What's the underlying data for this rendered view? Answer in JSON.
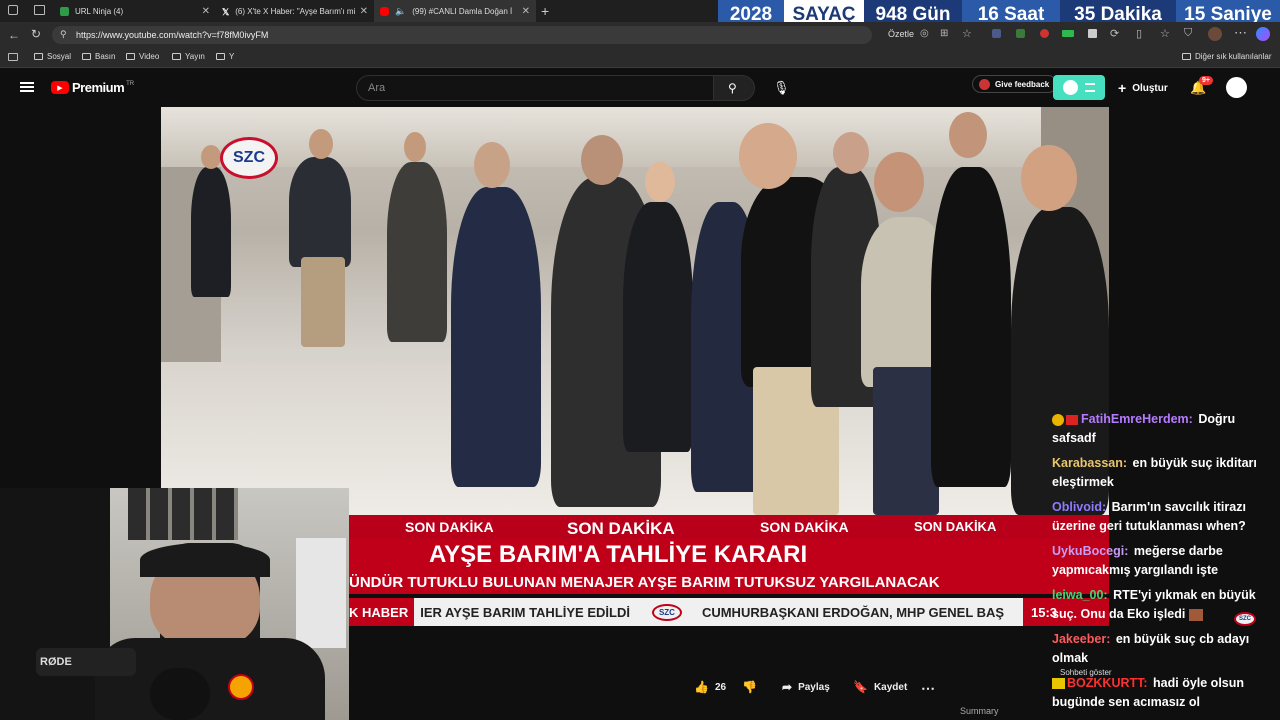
{
  "tabs": [
    {
      "label": "URL Ninja (4)",
      "color": "#2e9a4a"
    },
    {
      "label": "(6) X'te X Haber: \"Ayşe Barım'ı mi",
      "color": "#ffffff"
    },
    {
      "label": "(99) #CANLI Damla Doğan İ",
      "color": "#ff0000"
    }
  ],
  "counter": {
    "year": "2028",
    "label": "SAYAÇ",
    "days": "948 Gün",
    "hours": "16 Saat",
    "minutes": "35 Dakika",
    "seconds": "15 Saniye"
  },
  "address": {
    "url": "https://www.youtube.com/watch?v=f78fM0ivyFM",
    "summarize": "Özetle"
  },
  "bookmarks": [
    "Sosyal",
    "Basın",
    "Video",
    "Yayın",
    "Y"
  ],
  "other_bookmarks": "Diğer sık kullanılanlar",
  "youtube": {
    "brand": "Premium",
    "region": "TR",
    "search_placeholder": "Ara",
    "feedback": "Give feedback",
    "create": "Oluştur",
    "notif_count": "9+"
  },
  "overlay": {
    "logo": "SZC",
    "breaking": [
      "SON DAKİKA",
      "SON DAKİKA",
      "SON DAKİKA",
      "SON DAKİKA"
    ],
    "headline": "AYŞE BARIM'A TAHLİYE KARARI",
    "subline": "ÜNDÜR TUTUKLU BULUNAN MENAJER AYŞE BARIM TUTUKSUZ YARGILANACAK",
    "ticker_label": "K HABER",
    "ticker1": "IER AYŞE BARIM TAHLİYE EDİLDİ",
    "ticker2": "CUMHURBAŞKANI ERDOĞAN, MHP GENEL BAŞ",
    "clock": "15:3"
  },
  "actions": {
    "likes": "26",
    "share": "Paylaş",
    "save": "Kaydet",
    "summary": "Summary"
  },
  "chat": {
    "show_chat": "Sohbeti göster",
    "messages": [
      {
        "user": "FatihEmreHerdem:",
        "text": "Doğru safsadf",
        "color": "#b57bff"
      },
      {
        "user": "Karabassan:",
        "text": "en büyük suç ikditarı eleştirmek",
        "color": "#e8c66a"
      },
      {
        "user": "Oblivoid:",
        "text": "Barım'ın savcılık itirazı üzerine geri tutuklanması when?",
        "color": "#8e7bff"
      },
      {
        "user": "UykuBocegi:",
        "text": "meğerse darbe yapmıcakmış yargılandı işte",
        "color": "#c79cf5"
      },
      {
        "user": "leiwa_00:",
        "text": "RTE'yi yıkmak en büyük suç. Onu da Eko işledi",
        "color": "#4fd06f"
      },
      {
        "user": "Jakeeber:",
        "text": "en büyük suç cb adayı olmak",
        "color": "#ff5b5b"
      },
      {
        "user": "BOZKKURTT:",
        "text": "hadi öyle olsun bugünde sen acımasız ol",
        "color": "#ff3030"
      }
    ]
  }
}
